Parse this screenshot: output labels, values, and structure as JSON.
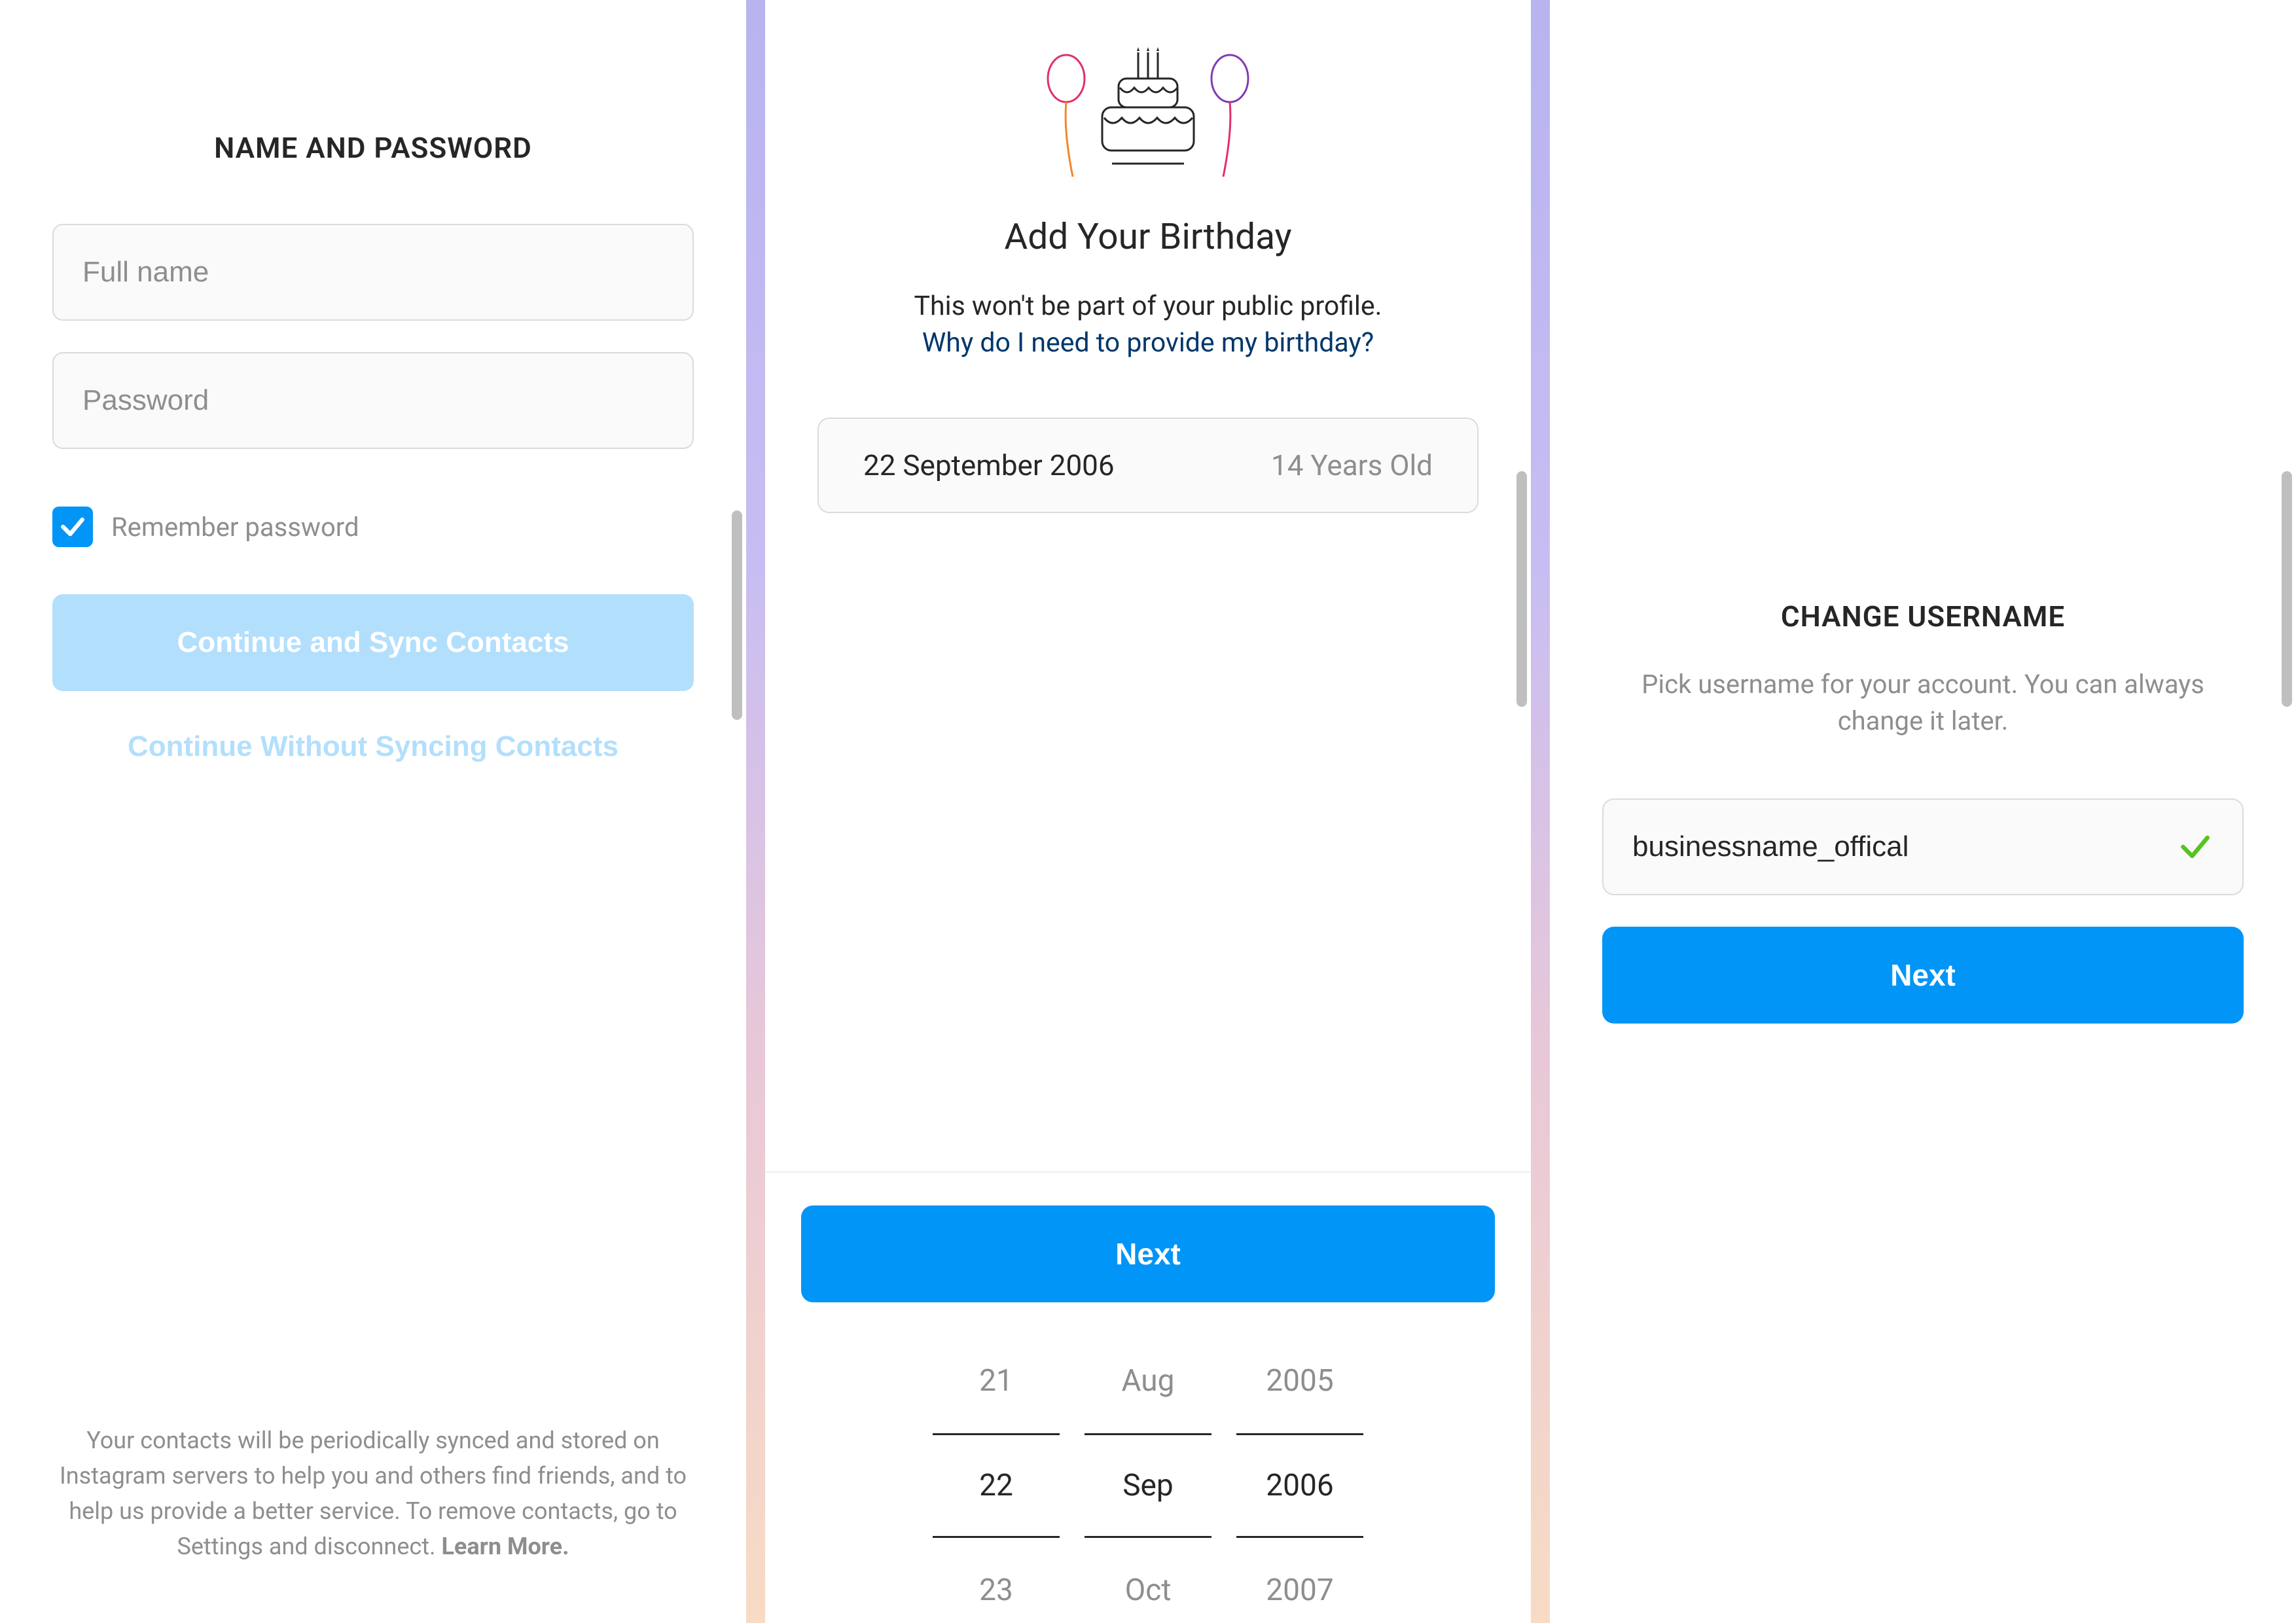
{
  "screen1": {
    "heading": "NAME AND PASSWORD",
    "fullname_placeholder": "Full name",
    "password_placeholder": "Password",
    "remember_label": "Remember password",
    "continue_sync": "Continue and Sync Contacts",
    "continue_nosync": "Continue Without Syncing Contacts",
    "footer_text": "Your contacts will be periodically synced and stored on Instagram servers to help you and others find friends, and to help us provide a better service. To remove contacts, go to Settings and disconnect. ",
    "footer_learn": "Learn More."
  },
  "screen2": {
    "heading": "Add Your Birthday",
    "subtext": "This won't be part of your public profile.",
    "whylink": "Why do I need to provide my birthday?",
    "date_display": "22 September 2006",
    "age_display": "14 Years Old",
    "next_label": "Next",
    "picker": {
      "day_prev": "21",
      "day_sel": "22",
      "day_next": "23",
      "mon_prev": "Aug",
      "mon_sel": "Sep",
      "mon_next": "Oct",
      "yr_prev": "2005",
      "yr_sel": "2006",
      "yr_next": "2007"
    }
  },
  "screen3": {
    "heading": "CHANGE USERNAME",
    "subtext": "Pick username for your account. You can always change it later.",
    "username_value": "businessname_offical",
    "next_label": "Next"
  }
}
